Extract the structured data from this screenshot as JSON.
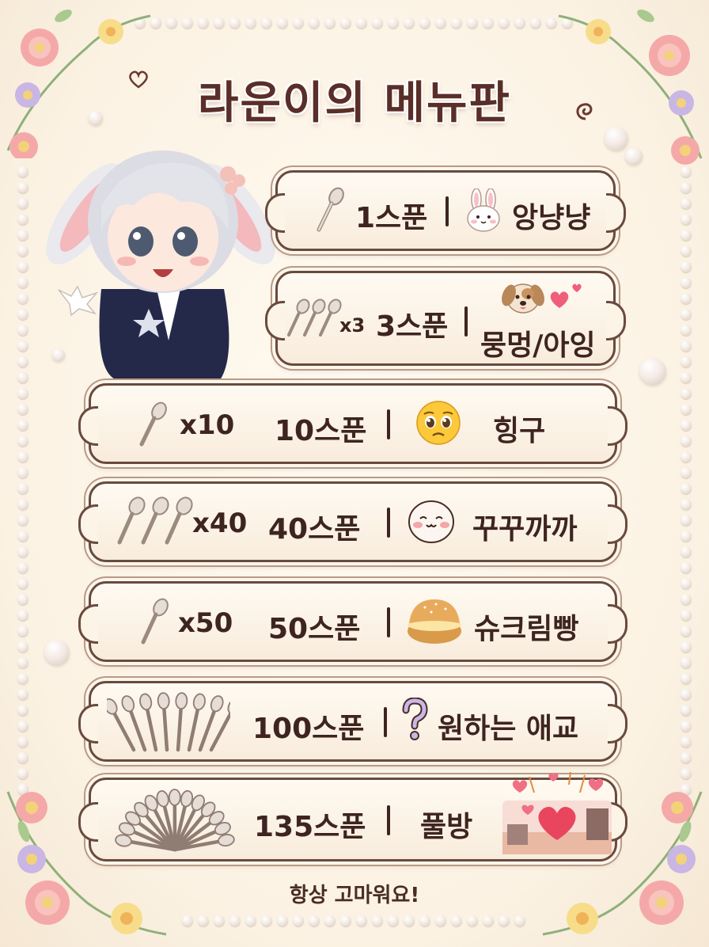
{
  "title": "라운이의 메뉴판",
  "menu": [
    {
      "multiplier": "",
      "spoons": "1스푼",
      "icon": "bunny-face-icon",
      "reward": "앙냥냥"
    },
    {
      "multiplier": "x3",
      "spoons": "3스푼",
      "icon": "puppy-hearts-icon",
      "reward": "뭉멍/아잉"
    },
    {
      "multiplier": "x10",
      "spoons": "10스푼",
      "icon": "pleading-face-icon",
      "reward": "힝구"
    },
    {
      "multiplier": "x40",
      "spoons": "40스푼",
      "icon": "mochi-face-icon",
      "reward": "꾸꾸까까"
    },
    {
      "multiplier": "x50",
      "spoons": "50스푼",
      "icon": "cream-puff-icon",
      "reward": "슈크림빵"
    },
    {
      "multiplier": "",
      "spoons": "100스푼",
      "icon": "question-mark-icon",
      "reward": "원하는 애교"
    },
    {
      "multiplier": "",
      "spoons": "135스푼",
      "icon": "heart-room-icon",
      "reward": "풀방"
    }
  ],
  "footer": "항상 고마워요!",
  "colors": {
    "text": "#3e2420",
    "card_border": "#6a4a3e",
    "background": "#fbf3e6"
  }
}
